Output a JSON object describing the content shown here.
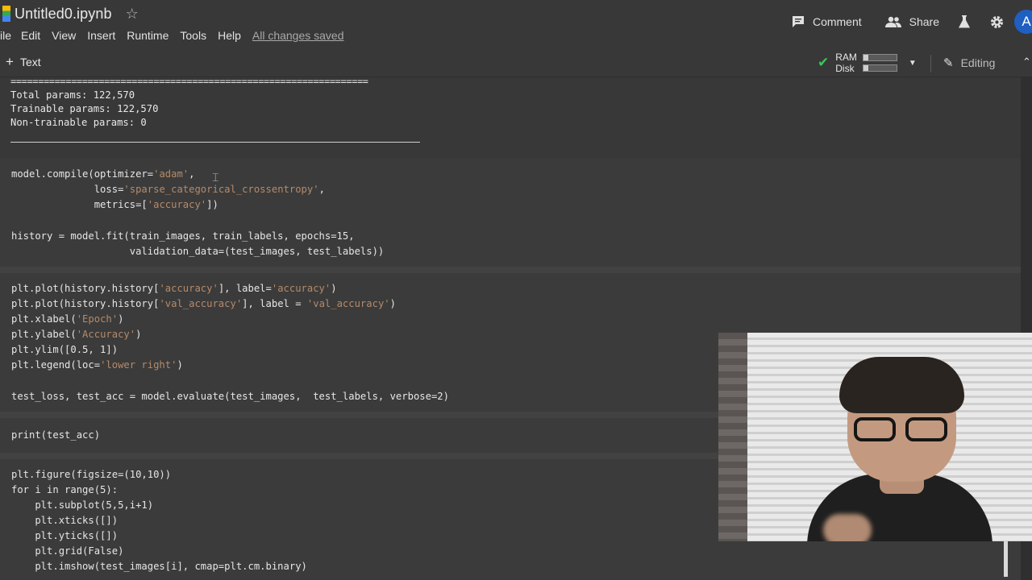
{
  "header": {
    "title": "Untitled0.ipynb",
    "star_icon": "star-icon",
    "menu": [
      "ile",
      "Edit",
      "View",
      "Insert",
      "Runtime",
      "Tools",
      "Help"
    ],
    "saved_status": "All changes saved",
    "comment_label": "Comment",
    "share_label": "Share",
    "avatar_letter": "A"
  },
  "toolbar": {
    "add_text_plus": "+",
    "add_text_label": "Text",
    "ram_label": "RAM",
    "disk_label": "Disk",
    "ram_usage": 0.15,
    "disk_usage": 0.15,
    "editing_label": "Editing"
  },
  "output": {
    "rule": "=================================================================",
    "lines": [
      "Total params: 122,570",
      "Trainable params: 122,570",
      "Non-trainable params: 0"
    ]
  },
  "cells": {
    "compile": {
      "l1a": "model.compile(optimizer=",
      "l1s": "'adam'",
      "l1b": ",",
      "l2a": "              loss=",
      "l2s": "'sparse_categorical_crossentropy'",
      "l2b": ",",
      "l3a": "              metrics=[",
      "l3s": "'accuracy'",
      "l3b": "])",
      "l4": "history = model.fit(train_images, train_labels, epochs=15,",
      "l5": "                    validation_data=(test_images, test_labels))"
    },
    "plot": {
      "l1a": "plt.plot(history.history[",
      "l1s": "'accuracy'",
      "l1b": "], label=",
      "l1s2": "'accuracy'",
      "l1c": ")",
      "l2a": "plt.plot(history.history[",
      "l2s": "'val_accuracy'",
      "l2b": "], label = ",
      "l2s2": "'val_accuracy'",
      "l2c": ")",
      "l3a": "plt.xlabel(",
      "l3s": "'Epoch'",
      "l3b": ")",
      "l4a": "plt.ylabel(",
      "l4s": "'Accuracy'",
      "l4b": ")",
      "l5": "plt.ylim([0.5, 1])",
      "l6a": "plt.legend(loc=",
      "l6s": "'lower right'",
      "l6b": ")",
      "l7": "test_loss, test_acc = model.evaluate(test_images,  test_labels, verbose=2)"
    },
    "print": {
      "l1": "print(test_acc)"
    },
    "figure": {
      "l1": "plt.figure(figsize=(10,10))",
      "l2": "for i in range(5):",
      "l3": "    plt.subplot(5,5,i+1)",
      "l4": "    plt.xticks([])",
      "l5": "    plt.yticks([])",
      "l6": "    plt.grid(False)",
      "l7": "    plt.imshow(test_images[i], cmap=plt.cm.binary)"
    }
  }
}
